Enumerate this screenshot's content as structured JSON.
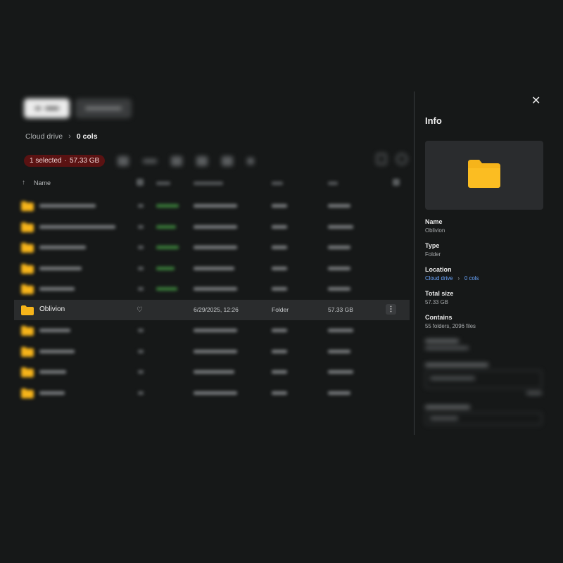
{
  "breadcrumb": {
    "root": "Cloud drive",
    "separator": "›",
    "current": "0 cols"
  },
  "selection": {
    "count_label": "1 selected",
    "dot": "·",
    "size": "57.33 GB"
  },
  "table": {
    "sort_icon": "↑",
    "name_header": "Name",
    "selected_row": {
      "name": "Oblivion",
      "favorite_icon": "♡",
      "date": "6/29/2025, 12:26",
      "type": "Folder",
      "size": "57.33 GB",
      "more_icon": "⋮"
    }
  },
  "info": {
    "close_icon": "✕",
    "title": "Info",
    "name_label": "Name",
    "name_value": "Oblivion",
    "type_label": "Type",
    "type_value": "Folder",
    "location_label": "Location",
    "location_root": "Cloud drive",
    "location_sep": "›",
    "location_current": "0 cols",
    "size_label": "Total size",
    "size_value": "57.33 GB",
    "contains_label": "Contains",
    "contains_value": "55 folders, 2096 files"
  },
  "colors": {
    "background": "#161818",
    "folder": "#f6b41a",
    "selection_pill": "#5a1212",
    "link": "#6aa6ff"
  }
}
